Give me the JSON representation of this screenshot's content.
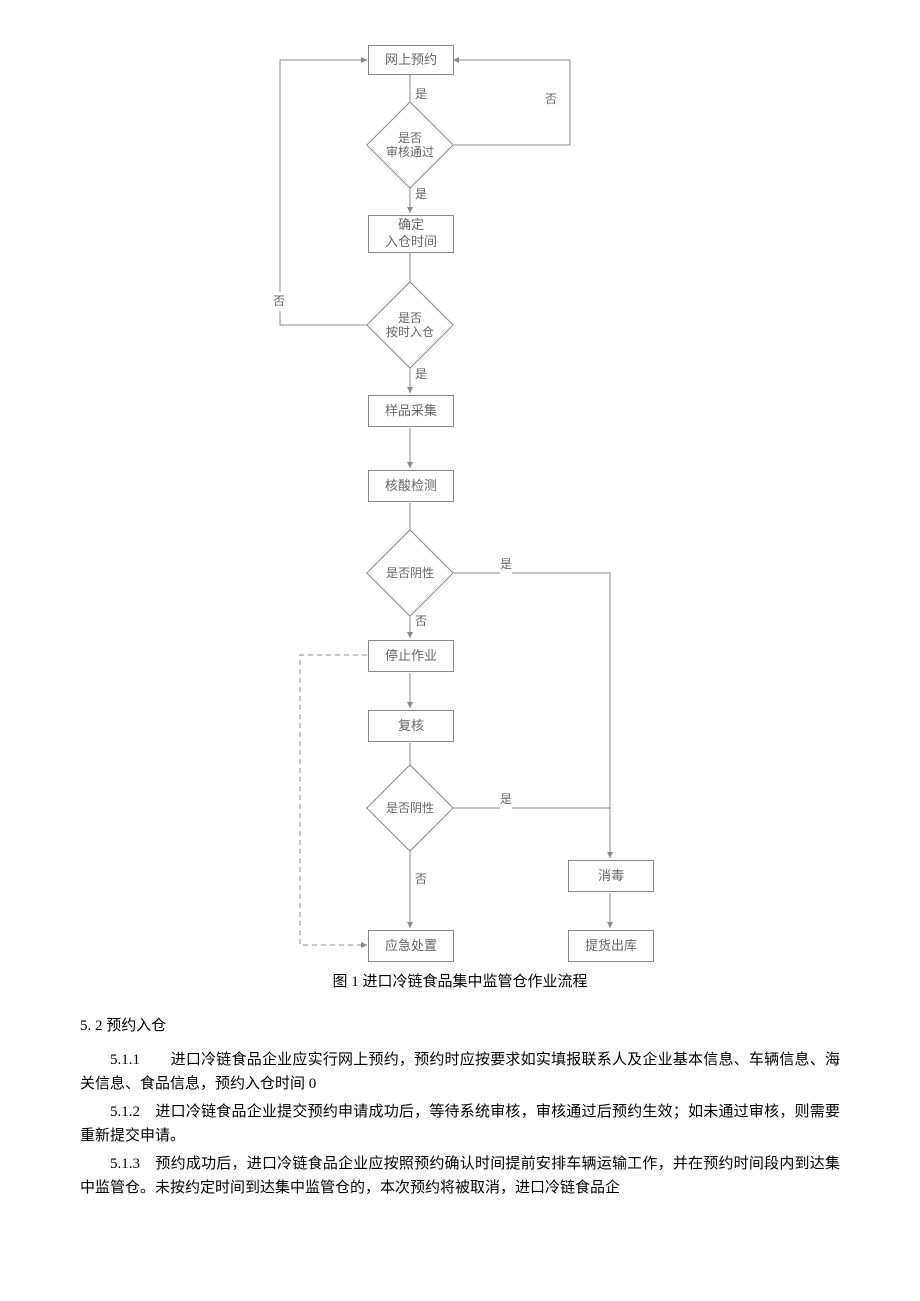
{
  "chart_data": {
    "type": "flowchart",
    "title": "图 1 进口冷链食品集中监管仓作业流程",
    "nodes": [
      {
        "id": "n1",
        "type": "process",
        "label": "网上预约"
      },
      {
        "id": "d1",
        "type": "decision",
        "label": "是否\n审核通过"
      },
      {
        "id": "n2",
        "type": "process",
        "label": "确定\n入仓时间"
      },
      {
        "id": "d2",
        "type": "decision",
        "label": "是否\n按时入仓"
      },
      {
        "id": "n3",
        "type": "process",
        "label": "样品采集"
      },
      {
        "id": "n4",
        "type": "process",
        "label": "核酸检测"
      },
      {
        "id": "d3",
        "type": "decision",
        "label": "是否阴性"
      },
      {
        "id": "n5",
        "type": "process",
        "label": "停止作业"
      },
      {
        "id": "n6",
        "type": "process",
        "label": "复核"
      },
      {
        "id": "d4",
        "type": "decision",
        "label": "是否阴性"
      },
      {
        "id": "n7",
        "type": "process",
        "label": "应急处置"
      },
      {
        "id": "n8",
        "type": "process",
        "label": "消毒"
      },
      {
        "id": "n9",
        "type": "process",
        "label": "提货出库"
      }
    ],
    "edges": [
      {
        "from": "n1",
        "to": "d1",
        "label": ""
      },
      {
        "from": "d1",
        "to": "n1",
        "label": "否",
        "style": "loop"
      },
      {
        "from": "d1",
        "to": "n2",
        "label": "是"
      },
      {
        "from": "n2",
        "to": "d2",
        "label": ""
      },
      {
        "from": "d2",
        "to": "n1",
        "label": "否",
        "style": "loop"
      },
      {
        "from": "d2",
        "to": "n3",
        "label": "是"
      },
      {
        "from": "n3",
        "to": "n4",
        "label": ""
      },
      {
        "from": "n4",
        "to": "d3",
        "label": ""
      },
      {
        "from": "d3",
        "to": "n8",
        "label": "是"
      },
      {
        "from": "d3",
        "to": "n5",
        "label": "否"
      },
      {
        "from": "n5",
        "to": "n6",
        "label": ""
      },
      {
        "from": "n5",
        "to": "n7",
        "label": "",
        "style": "dashed"
      },
      {
        "from": "n6",
        "to": "d4",
        "label": ""
      },
      {
        "from": "d4",
        "to": "n8",
        "label": "是"
      },
      {
        "from": "d4",
        "to": "n7",
        "label": "否"
      },
      {
        "from": "n8",
        "to": "n9",
        "label": ""
      }
    ]
  },
  "flow": {
    "n1": "网上预约",
    "d1_l1": "是否",
    "d1_l2": "审核通过",
    "n2_l1": "确定",
    "n2_l2": "入仓时间",
    "d2_l1": "是否",
    "d2_l2": "按时入仓",
    "n3": "样品采集",
    "n4": "核酸检测",
    "d3": "是否阴性",
    "n5": "停止作业",
    "n6": "复核",
    "d4": "是否阴性",
    "n7": "应急处置",
    "n8": "消毒",
    "n9": "提货出库",
    "yes": "是",
    "no": "否"
  },
  "caption": "图 1 进口冷链食品集中监管仓作业流程",
  "section": "5.  2 预约入仓",
  "p511": "5.1.1　　进口冷链食品企业应实行网上预约，预约时应按要求如实填报联系人及企业基本信息、车辆信息、海关信息、食品信息，预约入仓时间 0",
  "p512": "5.1.2　进口冷链食品企业提交预约申请成功后，等待系统审核，审核通过后预约生效；如未通过审核，则需要重新提交申请。",
  "p513": "5.1.3　预约成功后，进口冷链食品企业应按照预约确认时间提前安排车辆运输工作，并在预约时间段内到达集中监管仓。未按约定时间到达集中监管仓的，本次预约将被取消，进口冷链食品企"
}
